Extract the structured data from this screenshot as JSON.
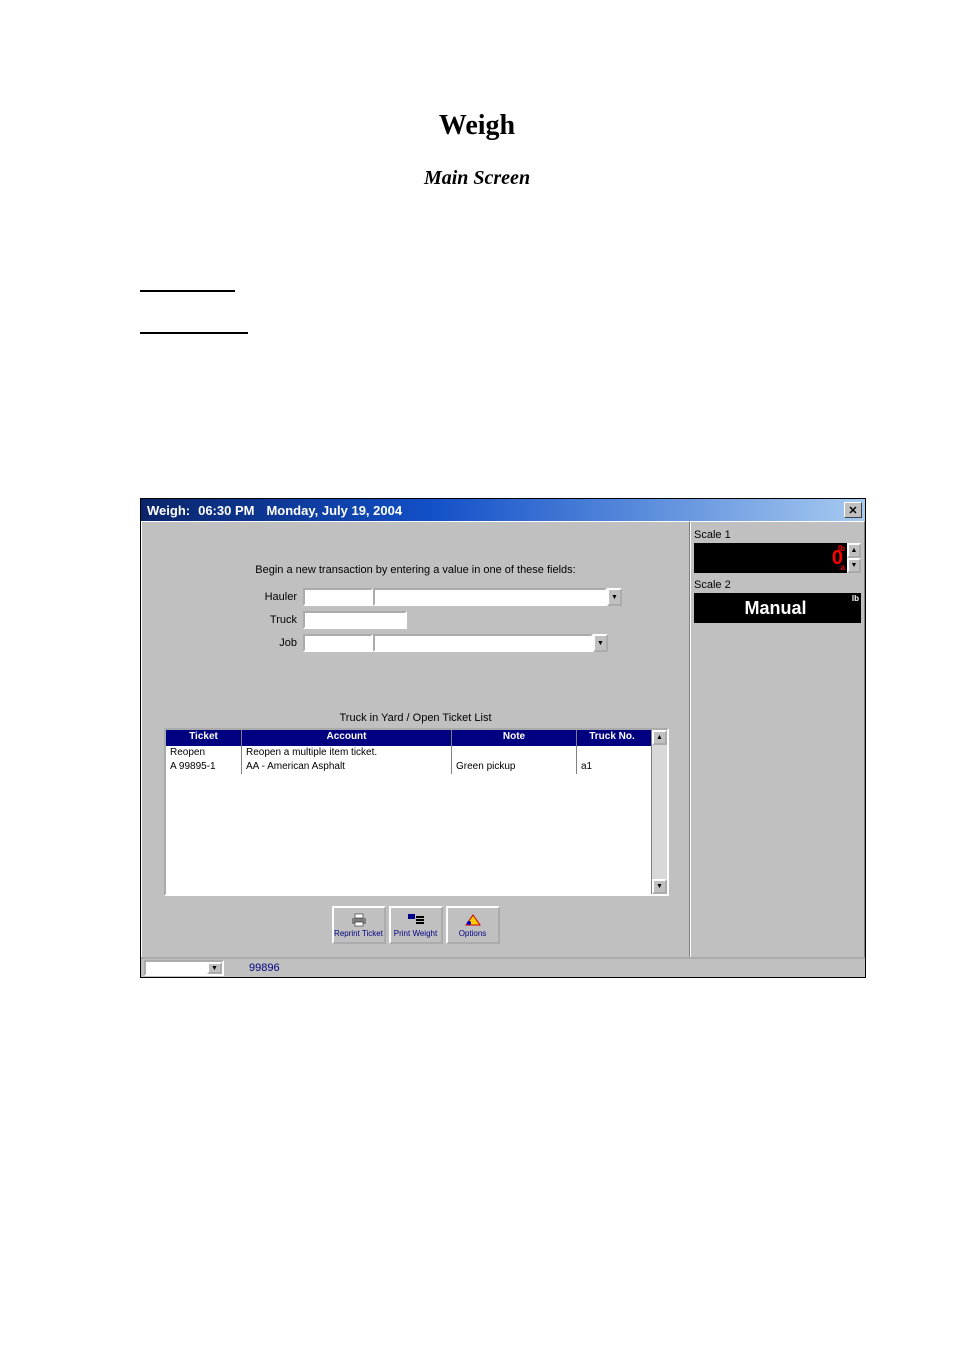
{
  "doc": {
    "title": "Weigh",
    "subtitle": "Main Screen"
  },
  "titlebar": {
    "app": "Weigh:",
    "time": "06:30 PM",
    "date": "Monday, July 19, 2004",
    "close": "✕"
  },
  "form": {
    "instruction": "Begin a new transaction by entering a value in one of these fields:",
    "hauler_label": "Hauler",
    "truck_label": "Truck",
    "job_label": "Job",
    "hauler_value": "",
    "truck_value": "",
    "job_value": ""
  },
  "list": {
    "heading": "Truck in Yard / Open Ticket List",
    "columns": {
      "ticket": "Ticket",
      "account": "Account",
      "note": "Note",
      "truck": "Truck No."
    },
    "rows": [
      {
        "ticket": "Reopen",
        "account": "Reopen a multiple item ticket.",
        "note": "",
        "truck": ""
      },
      {
        "ticket": "A 99895-1",
        "account": "AA - American Asphalt",
        "note": "Green pickup",
        "truck": "a1"
      }
    ]
  },
  "buttons": {
    "reprint": "Reprint Ticket",
    "printw": "Print Weight",
    "options": "Options"
  },
  "status": {
    "number": "99896"
  },
  "scales": {
    "s1_label": "Scale 1",
    "s1_value": "0",
    "s1_unit": "lb",
    "s1_mode": "a",
    "s2_label": "Scale 2",
    "s2_value": "Manual",
    "s2_unit": "lb"
  }
}
